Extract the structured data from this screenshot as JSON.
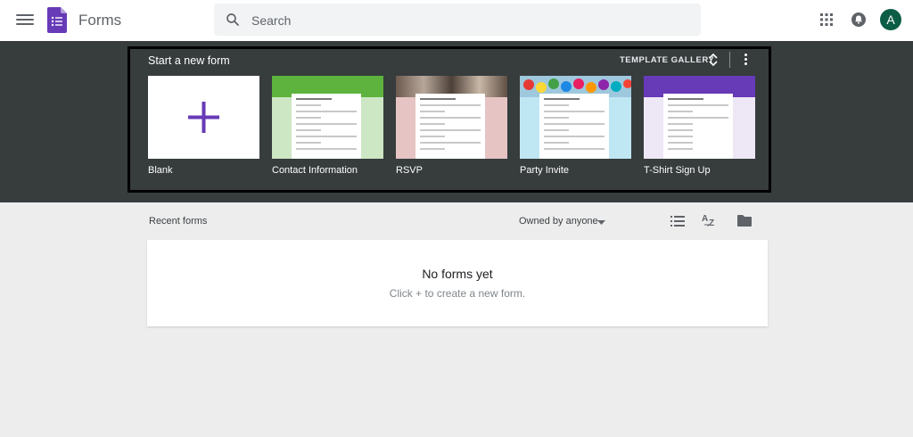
{
  "header": {
    "app_title": "Forms",
    "search_placeholder": "Search",
    "avatar_initial": "A",
    "colors": {
      "brand": "#673ab7",
      "avatar": "#0b5d45"
    }
  },
  "templates_section": {
    "title": "Start a new form",
    "gallery_label": "TEMPLATE GALLERY",
    "items": [
      {
        "label": "Blank",
        "icon": "plus-icon"
      },
      {
        "label": "Contact Information",
        "accent": "#5eb33e"
      },
      {
        "label": "RSVP",
        "accent": "#e6c4c4"
      },
      {
        "label": "Party Invite",
        "accent": "#bfe7f3"
      },
      {
        "label": "T-Shirt Sign Up",
        "accent": "#673ab7"
      }
    ]
  },
  "recent": {
    "title": "Recent forms",
    "owner_filter": "Owned by anyone",
    "empty_title": "No forms yet",
    "empty_subtitle": "Click + to create a new form."
  }
}
